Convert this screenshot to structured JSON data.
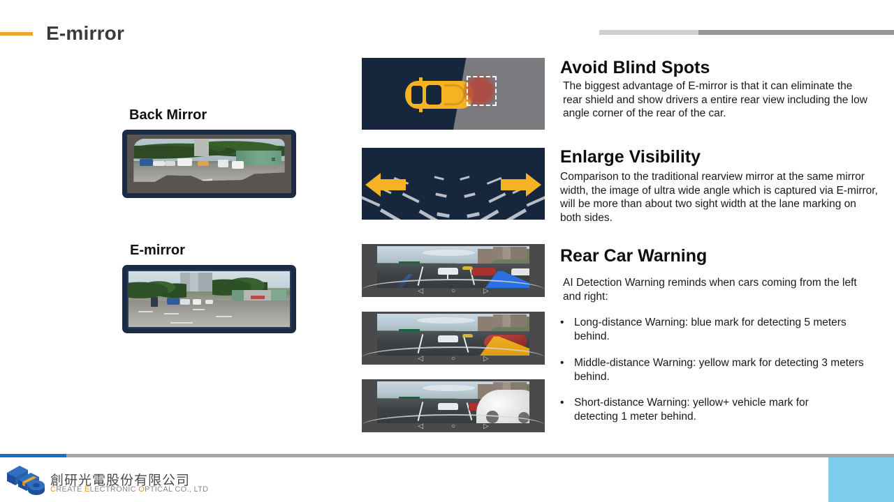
{
  "header": {
    "title": "E-mirror",
    "accent_color": "#e8a72b",
    "bar_light_color": "#cfcfcf",
    "bar_dark_color": "#969696"
  },
  "left_panel": {
    "items": [
      {
        "label": "Back Mirror",
        "image_alt": "narrow curved rear view of street with parked cars and green wall"
      },
      {
        "label": "E-mirror",
        "image_alt": "wide rear view of street with cyclist, cars, buildings and wall"
      }
    ]
  },
  "features": [
    {
      "title": "Avoid Blind Spots",
      "body": "The biggest advantage of E-mirror is that it can eliminate the rear shield and show drivers a entire rear view including the low angle corner of the rear of the car.",
      "figure": "blind-spot-diagram"
    },
    {
      "title": "Enlarge Visibility",
      "body": "Comparison to the traditional rearview mirror at the same mirror width, the image of ultra wide angle which is captured via E-mirror, will be more than about two sight width at the lane marking on both sides.",
      "figure": "lane-arrows-diagram"
    },
    {
      "title": "Rear Car Warning",
      "body": "AI Detection Warning reminds when cars coming from the left and right:",
      "bullets": [
        "Long-distance Warning: blue mark for detecting 5 meters behind.",
        "Middle-distance Warning: yellow mark for detecting 3 meters behind.",
        "Short-distance Warning: yellow+ vehicle  mark for detecting 1 meter behind."
      ],
      "figures": [
        "rear-camera-long-distance-blue-mark",
        "rear-camera-middle-distance-yellow-mark",
        "rear-camera-short-distance-yellow-vehicle-mark"
      ]
    }
  ],
  "camera_ui": {
    "left_glyph": "◁",
    "center_glyph": "○",
    "right_glyph": "▷"
  },
  "footer": {
    "company_cn": "創研光電股份有限公司",
    "company_en_parts": [
      "C",
      "REATE ",
      "E",
      "LECTRONIC ",
      "O",
      "PTICAL CO., LTD"
    ],
    "rule_blue_color": "#1073c4",
    "rule_gray_color": "#a6a6a6",
    "corner_block_color": "#7fcdee"
  }
}
